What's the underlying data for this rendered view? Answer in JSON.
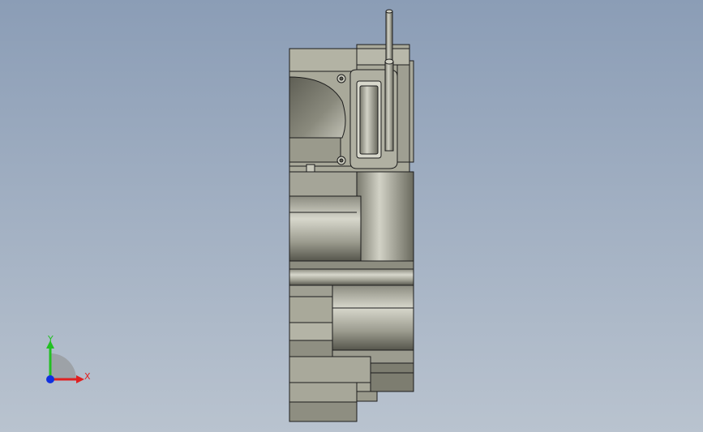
{
  "viewport": {
    "background_top": "#8b9db6",
    "background_bottom": "#b9c3cf"
  },
  "triad": {
    "x_label": "X",
    "y_label": "Y",
    "z_label": "Z",
    "x_color": "#e02020",
    "y_color": "#22c022",
    "z_color": "#1030e0"
  },
  "model": {
    "part_color": "#a9a99a",
    "edge_color": "#1c1c1c",
    "shade_color": "#6f6f64"
  }
}
